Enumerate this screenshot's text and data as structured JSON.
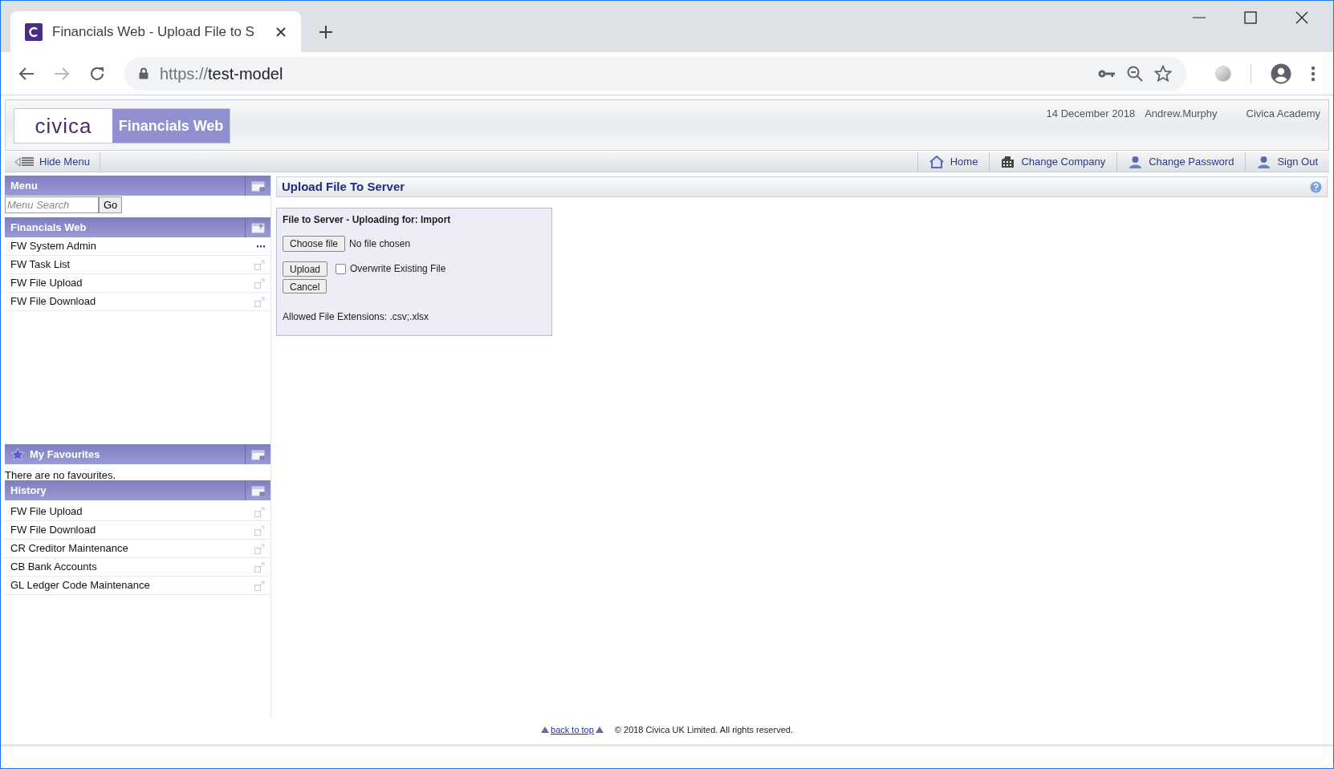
{
  "browser": {
    "tab_title": "Financials Web - Upload File to S",
    "url_scheme": "https://",
    "url_host": "test-model"
  },
  "header": {
    "logo": "civica",
    "product": "Financials Web",
    "date": "14 December 2018",
    "user": "Andrew.Murphy",
    "company": "Civica Academy"
  },
  "nav": {
    "hide_menu": "Hide Menu",
    "links": [
      {
        "label": "Home",
        "kind": "home"
      },
      {
        "label": "Change Company",
        "kind": "company"
      },
      {
        "label": "Change Password",
        "kind": "user"
      },
      {
        "label": "Sign Out",
        "kind": "user"
      }
    ]
  },
  "sidebar": {
    "menu": {
      "title": "Menu",
      "search_placeholder": "Menu Search",
      "go": "Go"
    },
    "financials": {
      "title": "Financials Web",
      "items": [
        {
          "label": "FW System Admin",
          "kind": "more"
        },
        {
          "label": "FW Task List",
          "kind": "open"
        },
        {
          "label": "FW File Upload",
          "kind": "open"
        },
        {
          "label": "FW File Download",
          "kind": "open"
        }
      ]
    },
    "favourites": {
      "title": "My Favourites",
      "empty_text": "There are no favourites."
    },
    "history": {
      "title": "History",
      "items": [
        {
          "label": "FW File Upload",
          "kind": "open"
        },
        {
          "label": "FW File Download",
          "kind": "open"
        },
        {
          "label": "CR Creditor Maintenance",
          "kind": "open"
        },
        {
          "label": "CB Bank Accounts",
          "kind": "open"
        },
        {
          "label": "GL Ledger Code Maintenance",
          "kind": "open"
        }
      ]
    }
  },
  "main": {
    "title": "Upload File To Server",
    "panel": {
      "heading": "File to Server - Uploading for: Import",
      "choose_file": "Choose file",
      "no_file": "No file chosen",
      "upload": "Upload",
      "overwrite": {
        "label": "Overwrite Existing File",
        "checked": false
      },
      "cancel": "Cancel",
      "allowed": "Allowed File Extensions: .csv;.xlsx"
    }
  },
  "footer": {
    "back_to_top": "back to top",
    "copyright": "© 2018 Civica UK Limited. All rights reserved."
  }
}
